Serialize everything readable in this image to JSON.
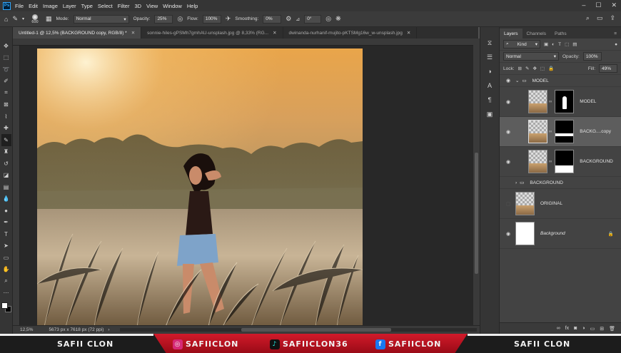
{
  "menubar": {
    "items": [
      "File",
      "Edit",
      "Image",
      "Layer",
      "Type",
      "Select",
      "Filter",
      "3D",
      "View",
      "Window",
      "Help"
    ]
  },
  "options": {
    "mode_label": "Mode:",
    "mode_value": "Normal",
    "opacity_label": "Opacity:",
    "opacity_value": "25%",
    "flow_label": "Flow:",
    "flow_value": "100%",
    "smoothing_label": "Smoothing:",
    "smoothing_value": "0%",
    "angle_value": "0°",
    "brush_size": "600"
  },
  "tabs": [
    {
      "label": "Untitled-1 @ 12,5% (BACKGROUND copy, RGB/8) *",
      "active": true
    },
    {
      "label": "sonnie-hiles-gPSMh7gmhAU-unsplash.jpg @ 8,33% (RG...",
      "active": false
    },
    {
      "label": "dwinanda-nurhanif-mujito-pKTSMg16w_w-unsplash.jpg",
      "active": false
    }
  ],
  "status": {
    "zoom": "12,5%",
    "dimensions": "5673 px x 7618 px (72 ppi)"
  },
  "layers_panel": {
    "tabs": [
      "Layers",
      "Channels",
      "Paths"
    ],
    "filter_kind": "Kind",
    "blend_mode": "Normal",
    "opacity_label": "Opacity:",
    "opacity_value": "100%",
    "lock_label": "Lock:",
    "fill_label": "Fill:",
    "fill_value": "49%",
    "layers": [
      {
        "type": "group",
        "name": "MODEL",
        "open": true
      },
      {
        "type": "layer",
        "name": "MODEL",
        "mask": "model"
      },
      {
        "type": "layer",
        "name": "BACKG....copy",
        "mask": "strip",
        "selected": true
      },
      {
        "type": "layer",
        "name": "BACKGROUND",
        "mask": "bottom"
      },
      {
        "type": "group",
        "name": "BACKGROUND",
        "open": false
      },
      {
        "type": "layer",
        "name": "ORIGINAL",
        "mask": "none"
      },
      {
        "type": "layer",
        "name": "Background",
        "mask": "none",
        "locked": true
      }
    ]
  },
  "banner": {
    "left_name": "SAFII CLON",
    "instagram": "SAFIICLON",
    "tiktok": "SAFIICLON36",
    "facebook": "SAFIICLON",
    "right_name": "SAFII CLON",
    "colors": {
      "red": "#c8141f",
      "instagram": "#d62976",
      "facebook": "#1877f2",
      "tiktok": "#25f4ee"
    }
  }
}
